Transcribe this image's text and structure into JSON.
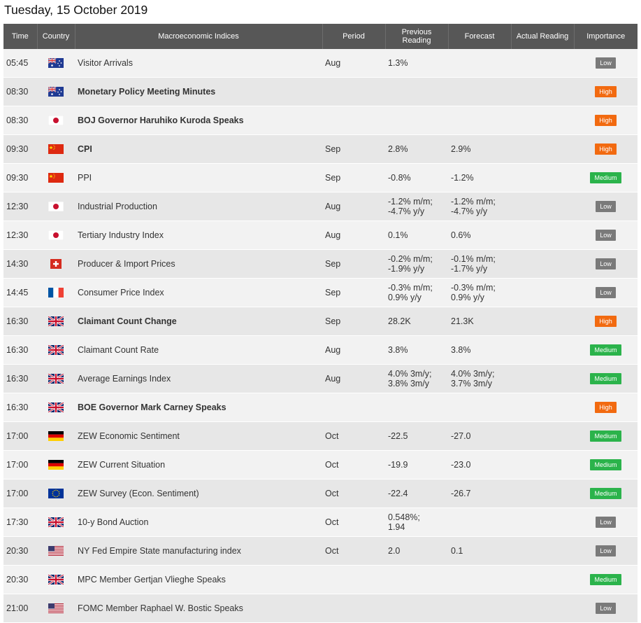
{
  "page": {
    "title": "Tuesday, 15 October 2019"
  },
  "headers": {
    "time": "Time",
    "country": "Country",
    "indices": "Macroeconomic Indices",
    "period": "Period",
    "previous_1": "Previous",
    "previous_2": "Reading",
    "forecast": "Forecast",
    "actual": "Actual Reading",
    "importance": "Importance"
  },
  "importance_colors": {
    "Low": "#7a7a7a",
    "High": "#f26a10",
    "Medium": "#2bb34b"
  },
  "rows": [
    {
      "time": "05:45",
      "country": "au-flag-icon",
      "indicator": "Visitor Arrivals",
      "bold": false,
      "period": "Aug",
      "previous": [
        "1.3%"
      ],
      "forecast": [],
      "actual": "",
      "importance": "Low"
    },
    {
      "time": "08:30",
      "country": "au-flag-icon",
      "indicator": "Monetary Policy Meeting Minutes",
      "bold": true,
      "period": "",
      "previous": [],
      "forecast": [],
      "actual": "",
      "importance": "High"
    },
    {
      "time": "08:30",
      "country": "jp-flag-icon",
      "indicator": "BOJ Governor Haruhiko Kuroda Speaks",
      "bold": true,
      "period": "",
      "previous": [],
      "forecast": [],
      "actual": "",
      "importance": "High"
    },
    {
      "time": "09:30",
      "country": "cn-flag-icon",
      "indicator": "CPI",
      "bold": true,
      "period": "Sep",
      "previous": [
        "2.8%"
      ],
      "forecast": [
        "2.9%"
      ],
      "actual": "",
      "importance": "High"
    },
    {
      "time": "09:30",
      "country": "cn-flag-icon",
      "indicator": "PPI",
      "bold": false,
      "period": "Sep",
      "previous": [
        "-0.8%"
      ],
      "forecast": [
        "-1.2%"
      ],
      "actual": "",
      "importance": "Medium"
    },
    {
      "time": "12:30",
      "country": "jp-flag-icon",
      "indicator": "Industrial Production",
      "bold": false,
      "period": "Aug",
      "previous": [
        "-1.2% m/m;",
        "-4.7% y/y"
      ],
      "forecast": [
        "-1.2% m/m;",
        "-4.7% y/y"
      ],
      "actual": "",
      "importance": "Low"
    },
    {
      "time": "12:30",
      "country": "jp-flag-icon",
      "indicator": "Tertiary Industry Index",
      "bold": false,
      "period": "Aug",
      "previous": [
        "0.1%"
      ],
      "forecast": [
        "0.6%"
      ],
      "actual": "",
      "importance": "Low"
    },
    {
      "time": "14:30",
      "country": "ch-flag-icon",
      "indicator": "Producer & Import Prices",
      "bold": false,
      "period": "Sep",
      "previous": [
        "-0.2% m/m;",
        "-1.9% y/y"
      ],
      "forecast": [
        "-0.1% m/m;",
        "-1.7% y/y"
      ],
      "actual": "",
      "importance": "Low"
    },
    {
      "time": "14:45",
      "country": "fr-flag-icon",
      "indicator": "Consumer Price Index",
      "bold": false,
      "period": "Sep",
      "previous": [
        "-0.3% m/m;",
        "0.9% y/y"
      ],
      "forecast": [
        "-0.3% m/m;",
        "0.9% y/y"
      ],
      "actual": "",
      "importance": "Low"
    },
    {
      "time": "16:30",
      "country": "gb-flag-icon",
      "indicator": "Claimant Count Change",
      "bold": true,
      "period": "Sep",
      "previous": [
        "28.2K"
      ],
      "forecast": [
        "21.3K"
      ],
      "actual": "",
      "importance": "High"
    },
    {
      "time": "16:30",
      "country": "gb-flag-icon",
      "indicator": "Claimant Count Rate",
      "bold": false,
      "period": "Aug",
      "previous": [
        "3.8%"
      ],
      "forecast": [
        "3.8%"
      ],
      "actual": "",
      "importance": "Medium"
    },
    {
      "time": "16:30",
      "country": "gb-flag-icon",
      "indicator": "Average Earnings Index",
      "bold": false,
      "period": "Aug",
      "previous": [
        "4.0% 3m/y;",
        "3.8% 3m/y"
      ],
      "forecast": [
        "4.0% 3m/y;",
        "3.7% 3m/y"
      ],
      "actual": "",
      "importance": "Medium"
    },
    {
      "time": "16:30",
      "country": "gb-flag-icon",
      "indicator": "BOE Governor Mark Carney Speaks",
      "bold": true,
      "period": "",
      "previous": [],
      "forecast": [],
      "actual": "",
      "importance": "High"
    },
    {
      "time": "17:00",
      "country": "de-flag-icon",
      "indicator": "ZEW Economic Sentiment",
      "bold": false,
      "period": "Oct",
      "previous": [
        "-22.5"
      ],
      "forecast": [
        "-27.0"
      ],
      "actual": "",
      "importance": "Medium"
    },
    {
      "time": "17:00",
      "country": "de-flag-icon",
      "indicator": "ZEW Current Situation",
      "bold": false,
      "period": "Oct",
      "previous": [
        "-19.9"
      ],
      "forecast": [
        "-23.0"
      ],
      "actual": "",
      "importance": "Medium"
    },
    {
      "time": "17:00",
      "country": "eu-flag-icon",
      "indicator": "ZEW Survey (Econ. Sentiment)",
      "bold": false,
      "period": "Oct",
      "previous": [
        "-22.4"
      ],
      "forecast": [
        "-26.7"
      ],
      "actual": "",
      "importance": "Medium"
    },
    {
      "time": "17:30",
      "country": "gb-flag-icon",
      "indicator": "10-y Bond Auction",
      "bold": false,
      "period": "Oct",
      "previous": [
        "0.548%;",
        "1.94"
      ],
      "forecast": [],
      "actual": "",
      "importance": "Low"
    },
    {
      "time": "20:30",
      "country": "us-flag-icon",
      "indicator": "NY Fed Empire State manufacturing index",
      "bold": false,
      "period": "Oct",
      "previous": [
        "2.0"
      ],
      "forecast": [
        "0.1"
      ],
      "actual": "",
      "importance": "Low"
    },
    {
      "time": "20:30",
      "country": "gb-flag-icon",
      "indicator": "MPC Member Gertjan Vlieghe Speaks",
      "bold": false,
      "period": "",
      "previous": [],
      "forecast": [],
      "actual": "",
      "importance": "Medium"
    },
    {
      "time": "21:00",
      "country": "us-flag-icon",
      "indicator": "FOMC Member Raphael W. Bostic Speaks",
      "bold": false,
      "period": "",
      "previous": [],
      "forecast": [],
      "actual": "",
      "importance": "Low"
    }
  ]
}
